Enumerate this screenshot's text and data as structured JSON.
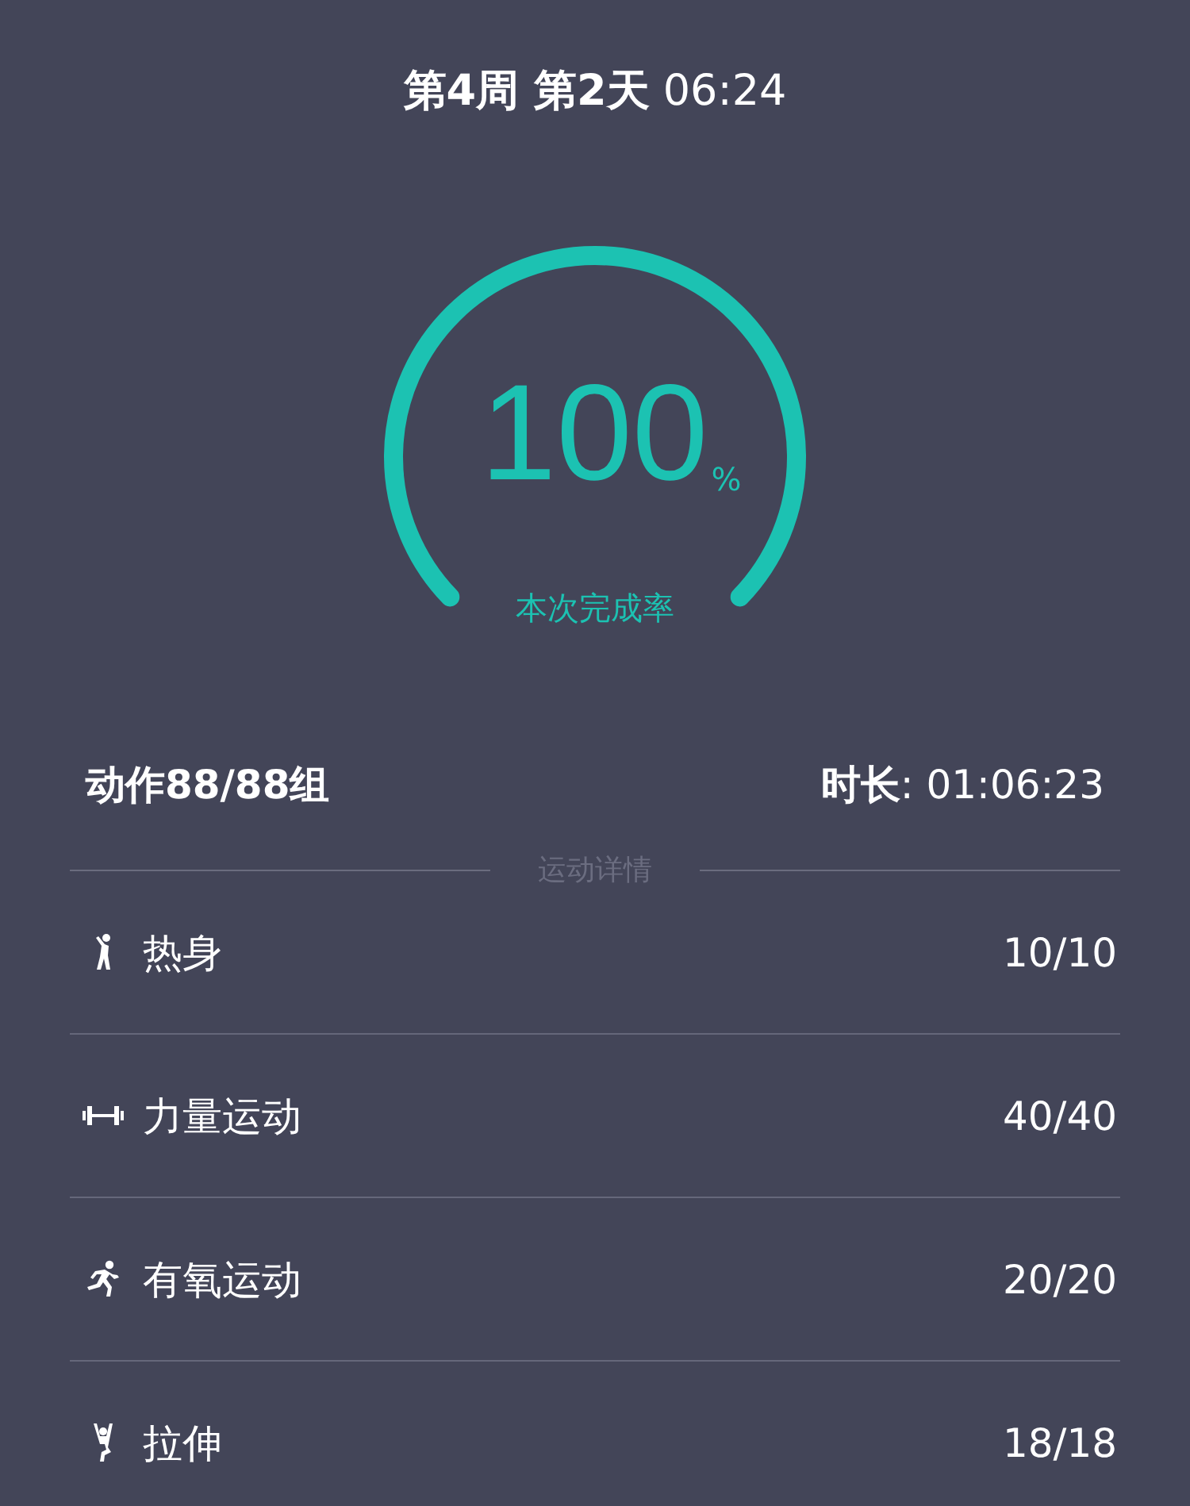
{
  "title": "**第4周 第2天** 06:24",
  "completion": {
    "value": "100",
    "unit": "%",
    "label": "本次完成率"
  },
  "summary": {
    "actions": "动作88/88组",
    "duration": "**时长**: 01:06:23"
  },
  "section_title": "运动详情",
  "categories": [
    {
      "kind": "warmup",
      "name": "热身",
      "count": "10/10"
    },
    {
      "kind": "strength",
      "name": "力量运动",
      "count": "40/40"
    },
    {
      "kind": "cardio",
      "name": "有氧运动",
      "count": "20/20"
    },
    {
      "kind": "stretch",
      "name": "拉伸",
      "count": "18/18"
    }
  ]
}
